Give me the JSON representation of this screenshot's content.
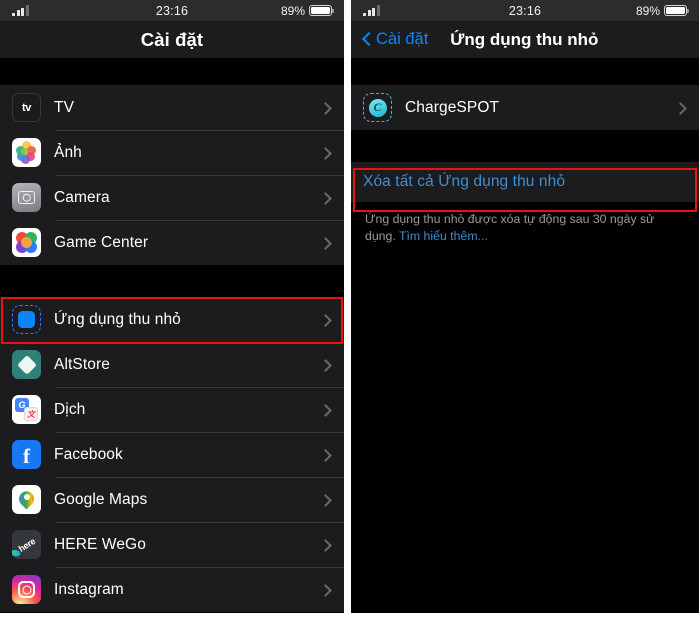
{
  "statusbar": {
    "time": "23:16",
    "battery_percent": "89%",
    "signal_icon": "cellular-signal-icon",
    "battery_icon": "battery-full-icon"
  },
  "left_panel": {
    "title": "Cài đặt",
    "groups": [
      {
        "rows": [
          {
            "label": "TV",
            "icon": "apple-tv-icon",
            "icon_text": "tv"
          },
          {
            "label": "Ảnh",
            "icon": "photos-icon"
          },
          {
            "label": "Camera",
            "icon": "camera-icon"
          },
          {
            "label": "Game Center",
            "icon": "game-center-icon"
          }
        ]
      },
      {
        "rows": [
          {
            "label": "Ứng dụng thu nhỏ",
            "icon": "app-clips-icon",
            "highlighted": true
          },
          {
            "label": "AltStore",
            "icon": "altstore-icon"
          },
          {
            "label": "Dịch",
            "icon": "translate-icon",
            "icon_text_a": "G",
            "icon_text_b": "文"
          },
          {
            "label": "Facebook",
            "icon": "facebook-icon",
            "icon_text": "f"
          },
          {
            "label": "Google Maps",
            "icon": "google-maps-icon"
          },
          {
            "label": "HERE WeGo",
            "icon": "here-wego-icon",
            "icon_text": "here"
          },
          {
            "label": "Instagram",
            "icon": "instagram-icon"
          }
        ]
      }
    ]
  },
  "right_panel": {
    "back_label": "Cài đặt",
    "title": "Ứng dụng thu nhỏ",
    "app_row": {
      "label": "ChargeSPOT",
      "icon": "chargespot-icon",
      "icon_text": "C"
    },
    "delete_all_label": "Xóa tất cả Ứng dụng thu nhỏ",
    "footer_text": "Ứng dụng thu nhỏ được xóa tự động sau 30 ngày sử dụng. ",
    "footer_link": "Tìm hiểu thêm..."
  },
  "colors": {
    "accent_blue": "#0a84ff",
    "link_blue": "#3e8ed0",
    "highlight_red": "#ee1111",
    "group_bg": "#1c1c1e",
    "page_bg": "#000000"
  }
}
